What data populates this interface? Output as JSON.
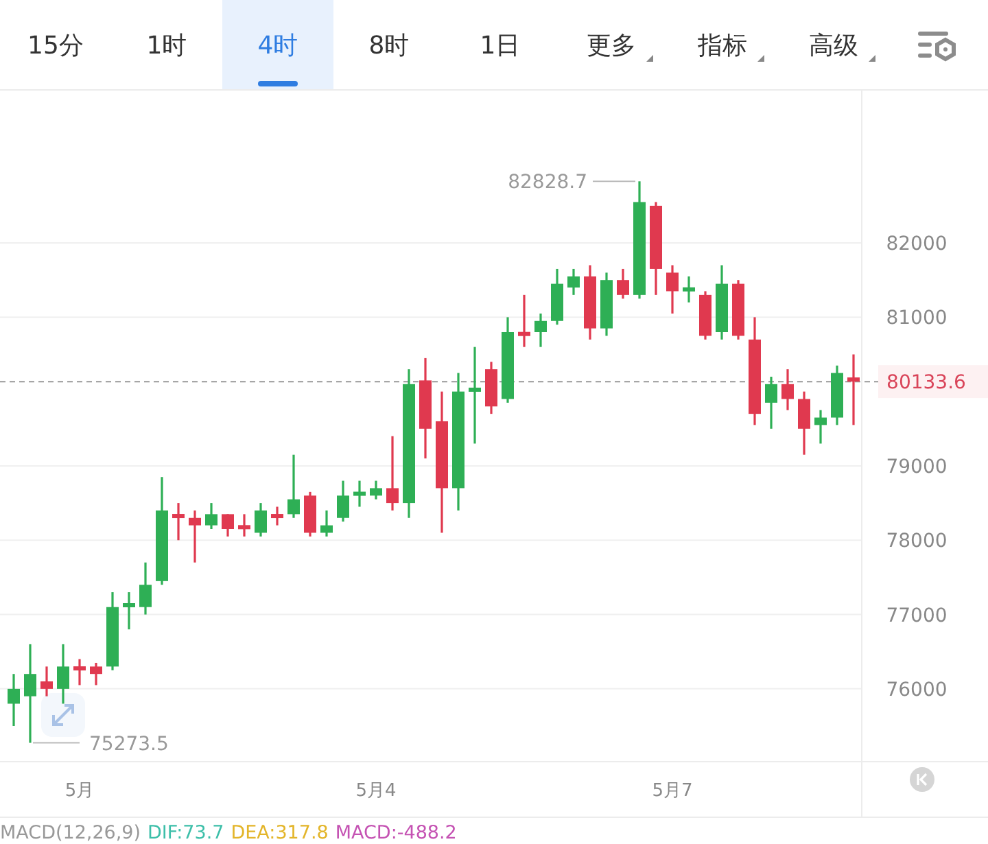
{
  "tabs": [
    {
      "label": "15分",
      "kind": "tab",
      "selected": false
    },
    {
      "label": "1时",
      "kind": "tab",
      "selected": false
    },
    {
      "label": "4时",
      "kind": "tab",
      "selected": true
    },
    {
      "label": "8时",
      "kind": "tab",
      "selected": false
    },
    {
      "label": "1日",
      "kind": "tab",
      "selected": false
    },
    {
      "label": "更多",
      "kind": "dropdown",
      "selected": false
    },
    {
      "label": "指标",
      "kind": "dropdown",
      "selected": false
    },
    {
      "label": "高级",
      "kind": "dropdown",
      "selected": false
    }
  ],
  "chart": {
    "chart_data": {
      "type": "candlestick",
      "ylim": [
        75020,
        84050
      ],
      "grid": true,
      "yticks": [
        76000,
        77000,
        78000,
        79000,
        81000,
        82000
      ],
      "ohlc": [
        [
          75800,
          76200,
          75500,
          76000
        ],
        [
          75900,
          76600,
          75273.5,
          76200
        ],
        [
          76100,
          76300,
          75900,
          76000
        ],
        [
          76000,
          76600,
          75800,
          76300
        ],
        [
          76300,
          76400,
          76050,
          76250
        ],
        [
          76300,
          76350,
          76050,
          76200
        ],
        [
          76300,
          77300,
          76250,
          77100
        ],
        [
          77100,
          77300,
          76800,
          77150
        ],
        [
          77100,
          77700,
          77000,
          77400
        ],
        [
          77450,
          78850,
          77400,
          78400
        ],
        [
          78350,
          78500,
          78000,
          78300
        ],
        [
          78300,
          78400,
          77700,
          78200
        ],
        [
          78200,
          78500,
          78150,
          78350
        ],
        [
          78350,
          78350,
          78050,
          78150
        ],
        [
          78200,
          78350,
          78050,
          78150
        ],
        [
          78100,
          78500,
          78050,
          78400
        ],
        [
          78350,
          78450,
          78200,
          78300
        ],
        [
          78350,
          79150,
          78300,
          78550
        ],
        [
          78600,
          78650,
          78050,
          78100
        ],
        [
          78100,
          78400,
          78050,
          78200
        ],
        [
          78300,
          78800,
          78250,
          78600
        ],
        [
          78600,
          78800,
          78450,
          78650
        ],
        [
          78600,
          78800,
          78550,
          78700
        ],
        [
          78700,
          79400,
          78400,
          78500
        ],
        [
          78500,
          80300,
          78300,
          80100
        ],
        [
          80150,
          80450,
          79100,
          79500
        ],
        [
          79600,
          80000,
          78100,
          78700
        ],
        [
          78700,
          80250,
          78400,
          80000
        ],
        [
          80000,
          80600,
          79300,
          80050
        ],
        [
          80300,
          80400,
          79700,
          79800
        ],
        [
          79900,
          81000,
          79850,
          80800
        ],
        [
          80800,
          81300,
          80600,
          80750
        ],
        [
          80800,
          81050,
          80600,
          80950
        ],
        [
          80950,
          81650,
          80900,
          81450
        ],
        [
          81400,
          81650,
          81300,
          81550
        ],
        [
          81550,
          81700,
          80700,
          80850
        ],
        [
          80850,
          81600,
          80750,
          81500
        ],
        [
          81500,
          81650,
          81250,
          81300
        ],
        [
          81300,
          82828.7,
          81250,
          82550
        ],
        [
          82500,
          82550,
          81300,
          81650
        ],
        [
          81600,
          81700,
          81050,
          81350
        ],
        [
          81350,
          81550,
          81200,
          81400
        ],
        [
          81300,
          81350,
          80700,
          80750
        ],
        [
          80800,
          81700,
          80700,
          81450
        ],
        [
          81450,
          81500,
          80700,
          80750
        ],
        [
          80700,
          81000,
          79550,
          79700
        ],
        [
          79850,
          80200,
          79500,
          80100
        ],
        [
          80100,
          80300,
          79750,
          79900
        ],
        [
          79900,
          80000,
          79150,
          79500
        ],
        [
          79550,
          79750,
          79300,
          79650
        ],
        [
          79650,
          80350,
          79550,
          80250
        ],
        [
          80190,
          80500,
          79550,
          80133.6
        ]
      ],
      "annotations": [
        "82828.7",
        "75273.5"
      ],
      "ref_lines": [
        {
          "axis": "y",
          "value": 80133.6,
          "label": "80133.6"
        }
      ]
    },
    "x_labels": [
      "5月",
      "5月4",
      "5月7"
    ]
  },
  "macd": [
    {
      "text": "MACD(12,26,9)",
      "color": "#999999"
    },
    {
      "text": "DIF:73.7",
      "color": "#3dbfa9"
    },
    {
      "text": "DEA:317.8",
      "color": "#e3b52a"
    },
    {
      "text": "MACD:-488.2",
      "color": "#c553b3"
    }
  ]
}
